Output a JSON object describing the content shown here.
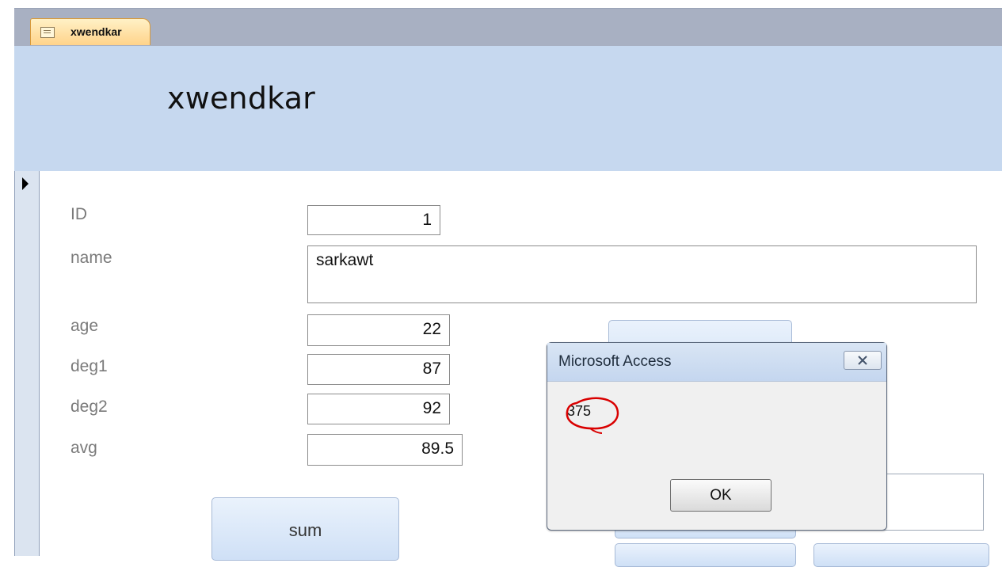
{
  "tab": {
    "label": "xwendkar",
    "icon": "form-icon"
  },
  "header": {
    "title": "xwendkar"
  },
  "record_selector": {
    "icon": "current-record-arrow-icon"
  },
  "fields": {
    "id": {
      "label": "ID",
      "value": "1"
    },
    "name": {
      "label": "name",
      "value": "sarkawt"
    },
    "age": {
      "label": "age",
      "value": "22"
    },
    "deg1": {
      "label": "deg1",
      "value": "87"
    },
    "deg2": {
      "label": "deg2",
      "value": "92"
    },
    "avg": {
      "label": "avg",
      "value": "89.5"
    }
  },
  "buttons": {
    "sum": "sum"
  },
  "dialog": {
    "title": "Microsoft Access",
    "message": "375",
    "ok_label": "OK",
    "close_icon": "close-icon",
    "highlight_color": "#d90000"
  }
}
